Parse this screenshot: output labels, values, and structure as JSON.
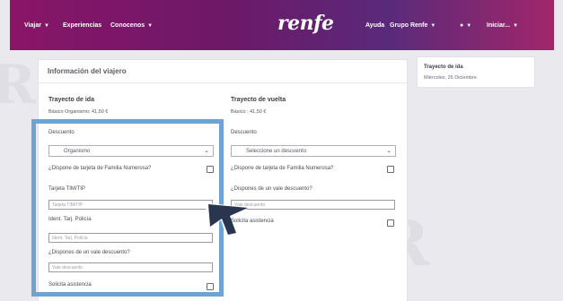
{
  "watermark": {
    "text_top": "renfe",
    "text_left": "R",
    "text_right": "R"
  },
  "header": {
    "nav": [
      {
        "label": "Viajar"
      },
      {
        "label": "Experiencias"
      },
      {
        "label": "Conocenos"
      }
    ],
    "logo": "renfe",
    "right": {
      "help": "Ayuda",
      "group": "Grupo Renfe",
      "lang": "●",
      "user": "Iniciar..."
    }
  },
  "main_card": {
    "title": "Información del viajero",
    "outbound": {
      "title": "Trayecto de ida",
      "fare": "Básico Organismo: 41,50 €",
      "discount_label": "Descuento",
      "discount_value": "Organismo",
      "family_question": "¿Dispone de tarjeta de Familia Numerosa?",
      "tmp_label": "Tarjeta TIM/TIP",
      "tmp_placeholder": "Tarjeta TIM/TIP",
      "police_label": "Ident. Tarj. Policía",
      "police_placeholder": "Ident. Tarj. Policía",
      "voucher_question": "¿Dispones de un vale descuento?",
      "voucher_placeholder": "Vale descuento",
      "assist_label": "Solicita asistencia"
    },
    "return": {
      "title": "Trayecto de vuelta",
      "fare": "Básico : 41,50 €",
      "discount_label": "Descuento",
      "discount_value": "Seleccione un descuento",
      "family_question": "¿Dispone de tarjeta de Familia Numerosa?",
      "voucher_question": "¿Dispones de un vale descuento?",
      "voucher_placeholder": "Vale descuento",
      "assist_label": "Solicita asistencia"
    }
  },
  "side_card": {
    "title": "Trayecto de ida",
    "date": "Miércoles, 26 Diciembre"
  },
  "colors": {
    "header_start": "#8a1567",
    "header_end": "#a2266a",
    "highlight": "#6fa3d2",
    "accent_red": "#c22047"
  }
}
